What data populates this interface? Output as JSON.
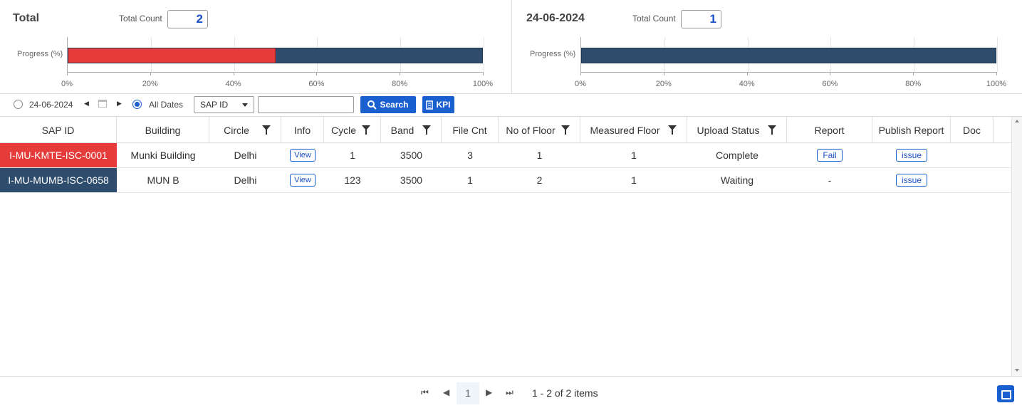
{
  "summary": {
    "left": {
      "title": "Total",
      "count_label": "Total Count",
      "count": "2",
      "ylabel": "Progress (%)",
      "fill_fraction": 0.5
    },
    "right": {
      "title": "24-06-2024",
      "count_label": "Total Count",
      "count": "1",
      "ylabel": "Progress (%)",
      "fill_fraction": 0.0
    }
  },
  "chart_data": [
    {
      "type": "bar",
      "orientation": "horizontal",
      "title": "Total",
      "ylabel": "Progress (%)",
      "xlim": [
        0,
        100
      ],
      "ticks": [
        "0%",
        "20%",
        "40%",
        "60%",
        "80%",
        "100%"
      ],
      "series": [
        {
          "values": [
            50
          ],
          "color": "#e63b3b"
        },
        {
          "values": [
            50
          ],
          "color": "#2e4c6b"
        }
      ]
    },
    {
      "type": "bar",
      "orientation": "horizontal",
      "title": "24-06-2024",
      "ylabel": "Progress (%)",
      "xlim": [
        0,
        100
      ],
      "ticks": [
        "0%",
        "20%",
        "40%",
        "60%",
        "80%",
        "100%"
      ],
      "series": [
        {
          "values": [
            0
          ],
          "color": "#e63b3b"
        },
        {
          "values": [
            100
          ],
          "color": "#2e4c6b"
        }
      ]
    }
  ],
  "toolbar": {
    "date_option": "24-06-2024",
    "all_dates_label": "All Dates",
    "selected": "all",
    "select_value": "SAP ID",
    "search_value": "",
    "search_label": "Search",
    "kpi_label": "KPI"
  },
  "table": {
    "columns": [
      "SAP ID",
      "Building",
      "Circle",
      "Info",
      "Cycle",
      "Band",
      "File Cnt",
      "No of Floor",
      "Measured Floor",
      "Upload Status",
      "Report",
      "Publish Report",
      "Doc"
    ],
    "rows": [
      {
        "sap_id": "I-MU-KMTE-ISC-0001",
        "sap_color": "#e63b3b",
        "building": "Munki Building",
        "circle": "Delhi",
        "info": "View",
        "cycle": "1",
        "band": "3500",
        "file_cnt": "3",
        "no_of_floor": "1",
        "measured_floor": "1",
        "upload_status": "Complete",
        "report": "Fail",
        "publish_report": "issue",
        "doc": ""
      },
      {
        "sap_id": "I-MU-MUMB-ISC-0658",
        "sap_color": "#2e4c6b",
        "building": "MUN B",
        "circle": "Delhi",
        "info": "View",
        "cycle": "123",
        "band": "3500",
        "file_cnt": "1",
        "no_of_floor": "2",
        "measured_floor": "1",
        "upload_status": "Waiting",
        "report": "-",
        "publish_report": "issue",
        "doc": ""
      }
    ]
  },
  "pager": {
    "current_page": "1",
    "info": "1 - 2 of 2 items"
  },
  "colors": {
    "accent": "#1a5fd0",
    "fail": "#e63b3b",
    "complete_bar": "#2e4c6b"
  }
}
